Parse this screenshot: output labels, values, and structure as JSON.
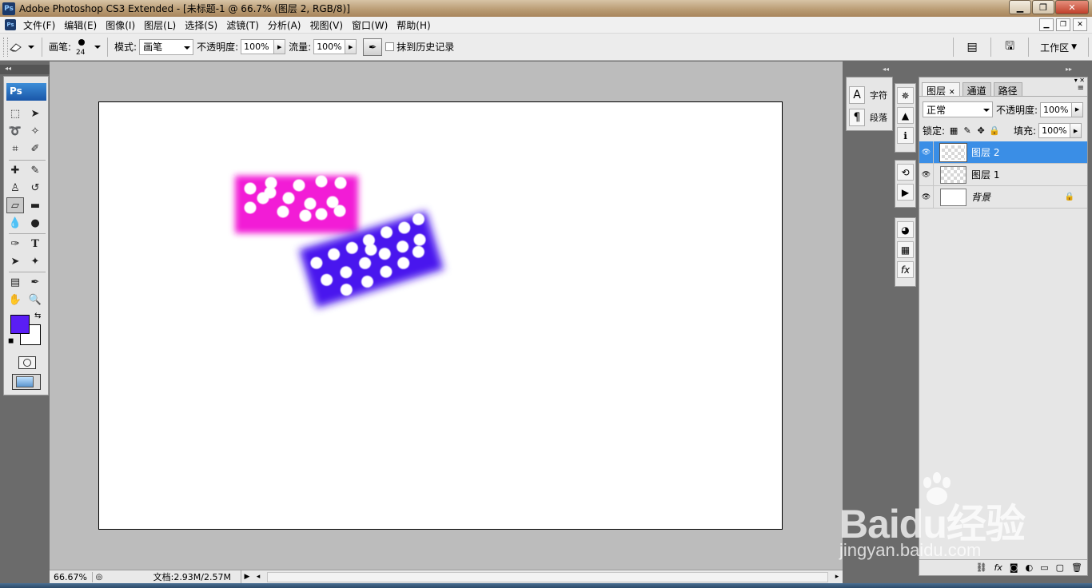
{
  "window": {
    "title": "Adobe Photoshop CS3 Extended - [未标题-1 @ 66.7% (图层 2, RGB/8)]",
    "app_icon": "Ps",
    "controls": [
      "minimize",
      "maximize",
      "close"
    ]
  },
  "menu": {
    "items": [
      "文件(F)",
      "编辑(E)",
      "图像(I)",
      "图层(L)",
      "选择(S)",
      "滤镜(T)",
      "分析(A)",
      "视图(V)",
      "窗口(W)",
      "帮助(H)"
    ]
  },
  "options_bar": {
    "tool_icon": "eraser-icon",
    "brush_label": "画笔:",
    "brush_size": "24",
    "mode_label": "模式:",
    "mode_value": "画笔",
    "opacity_label": "不透明度:",
    "opacity_value": "100%",
    "flow_label": "流量:",
    "flow_value": "100%",
    "erase_history_label": "抹到历史记录",
    "erase_history_checked": false,
    "workspace_label": "工作区"
  },
  "toolbox": {
    "logo": "Ps",
    "foreground_color": "#5a1ef5",
    "background_color": "#ffffff"
  },
  "canvas_content": {
    "shapes": [
      {
        "name": "magenta-domino",
        "color": "#f21fd6",
        "dots": 15
      },
      {
        "name": "blue-domino",
        "color": "#4a18ee",
        "dots": 19
      }
    ]
  },
  "status": {
    "zoom": "66.67%",
    "doc_info": "文档:2.93M/2.57M"
  },
  "char_panel": {
    "character_label": "字符",
    "paragraph_label": "段落"
  },
  "layers_panel": {
    "tabs": [
      "图层",
      "通道",
      "路径"
    ],
    "active_tab": "图层",
    "blend_mode": "正常",
    "opacity_label": "不透明度:",
    "opacity_value": "100%",
    "lock_label": "锁定:",
    "fill_label": "填充:",
    "fill_value": "100%",
    "layers": [
      {
        "name": "图层 2",
        "active": true,
        "visible": true
      },
      {
        "name": "图层 1",
        "active": false,
        "visible": true
      },
      {
        "name": "背景",
        "active": false,
        "visible": true,
        "locked": true
      }
    ]
  },
  "watermark": {
    "text": "Baidu经验",
    "url": "jingyan.baidu.com"
  }
}
